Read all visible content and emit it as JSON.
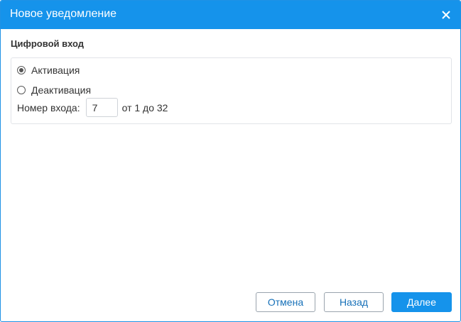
{
  "dialog": {
    "title": "Новое уведомление"
  },
  "section": {
    "title": "Цифровой вход"
  },
  "options": {
    "activation_label": "Активация",
    "deactivation_label": "Деактивация",
    "selected": "activation"
  },
  "input_number": {
    "label": "Номер входа:",
    "value": "7",
    "range_hint": "от 1 до 32"
  },
  "footer": {
    "cancel_label": "Отмена",
    "back_label": "Назад",
    "next_label": "Далее"
  },
  "colors": {
    "accent": "#1593eb",
    "outline_text": "#1670b8"
  }
}
